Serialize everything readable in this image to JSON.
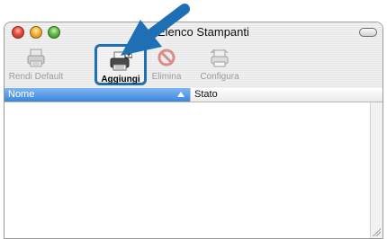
{
  "window": {
    "title": "Elenco Stampanti"
  },
  "toolbar": {
    "items": [
      {
        "label": "Rendi Default",
        "icon": "printer-icon"
      },
      {
        "label": "Aggiungi",
        "icon": "add-printer-icon"
      },
      {
        "label": "Elimina",
        "icon": "delete-icon"
      },
      {
        "label": "Configura",
        "icon": "configure-printer-icon"
      }
    ]
  },
  "columns": {
    "name": "Nome",
    "status": "Stato"
  },
  "colors": {
    "highlight_arrow": "#1e6fb3",
    "selected_header": "#3a86dd"
  }
}
